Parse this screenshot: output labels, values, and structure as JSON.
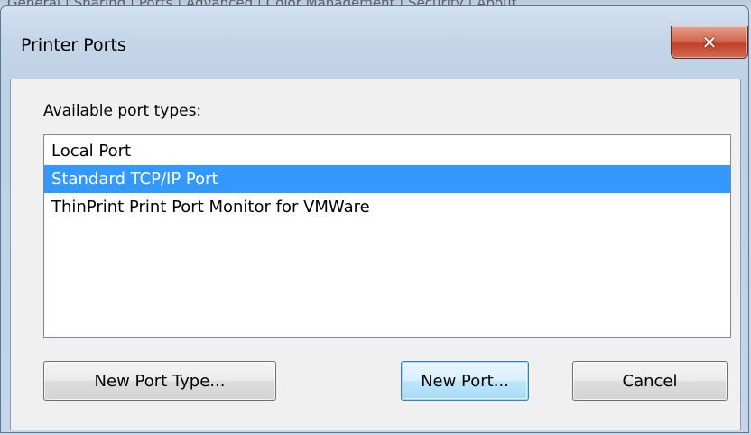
{
  "dialog": {
    "title": "Printer Ports",
    "available_label": "Available port types:",
    "ports": [
      {
        "label": "Local Port",
        "selected": false
      },
      {
        "label": "Standard TCP/IP Port",
        "selected": true
      },
      {
        "label": "ThinPrint Print Port Monitor for VMWare",
        "selected": false
      }
    ],
    "buttons": {
      "new_port_type": "New Port Type...",
      "new_port": "New Port...",
      "cancel": "Cancel"
    }
  },
  "background_window": {
    "text": "General | Sharing | Ports | Advanced | Color Management | Security | About"
  },
  "colors": {
    "selection": "#3399ff",
    "close_button": "#c1412a",
    "dialog_face": "#f0f0f0",
    "frame": "#c4d5e8"
  },
  "icons": {
    "close": "close-icon"
  }
}
